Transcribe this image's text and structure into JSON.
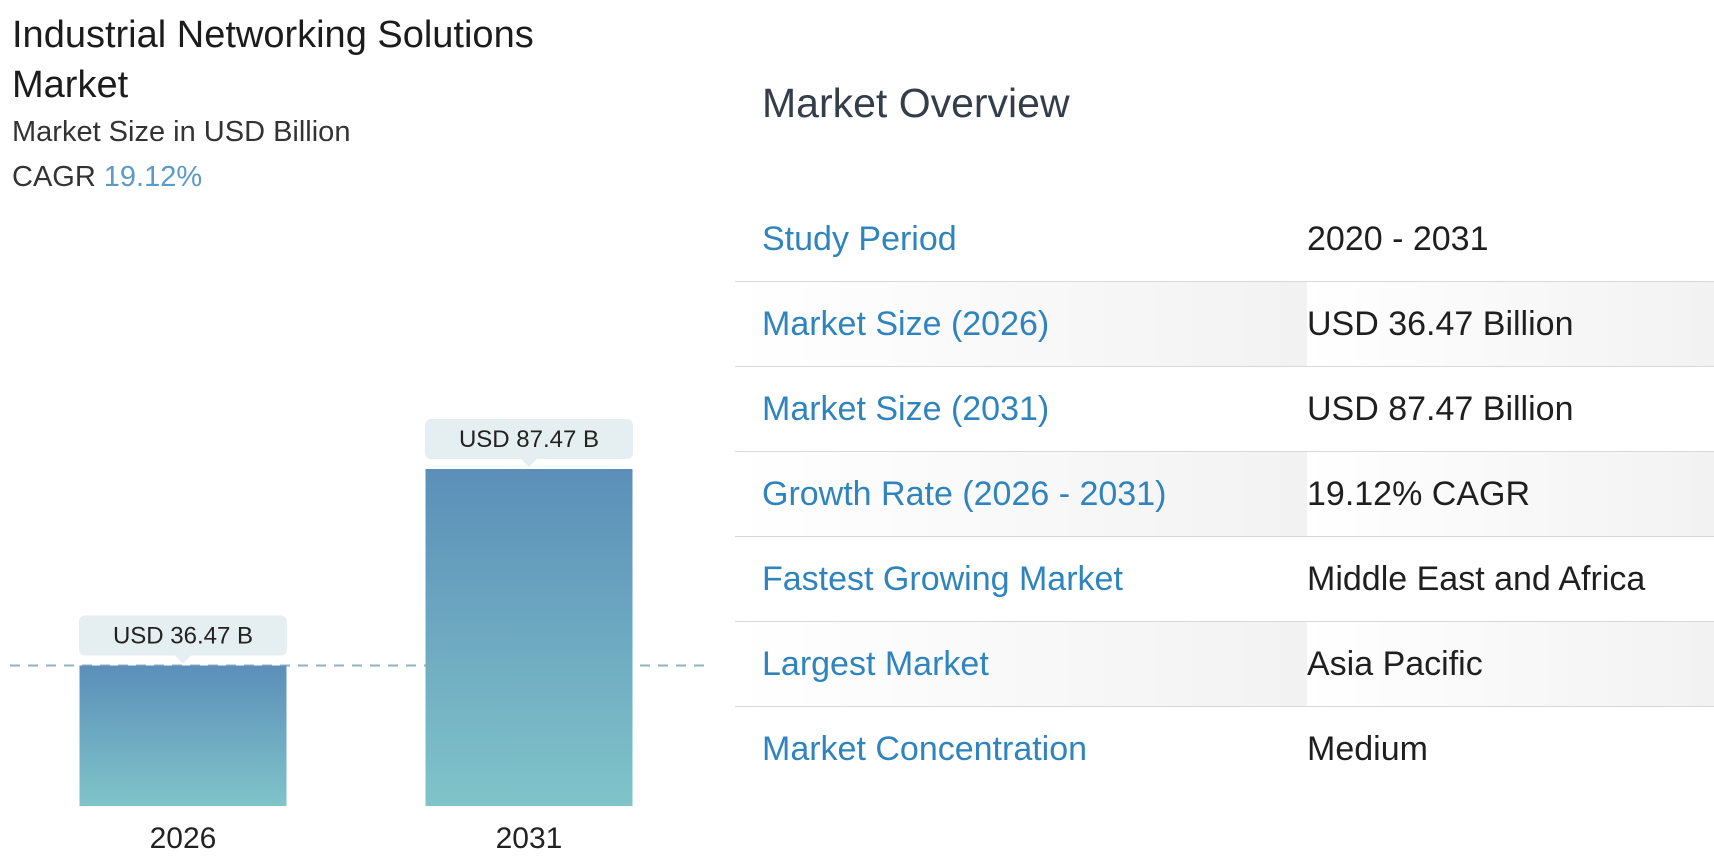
{
  "chart": {
    "title": "Industrial Networking Solutions Market",
    "subtitle": "Market Size in USD Billion",
    "cagr_label": "CAGR",
    "cagr_value": "19.12%"
  },
  "overview": {
    "title": "Market Overview",
    "rows": [
      {
        "label": "Study Period",
        "value": "2020 - 2031"
      },
      {
        "label": "Market Size (2026)",
        "value": "USD 36.47 Billion"
      },
      {
        "label": "Market Size (2031)",
        "value": "USD 87.47 Billion"
      },
      {
        "label": "Growth Rate (2026 - 2031)",
        "value": "19.12% CAGR"
      },
      {
        "label": "Fastest Growing Market",
        "value": "Middle East and Africa"
      },
      {
        "label": "Largest Market",
        "value": "Asia Pacific"
      },
      {
        "label": "Market Concentration",
        "value": "Medium"
      }
    ]
  },
  "colors": {
    "bar_top": "#5b8fb9",
    "bar_bottom": "#80c4c9",
    "accent": "#5b9bc9",
    "label_blue": "#2f84bd",
    "callout_bg": "#e5eef1"
  },
  "chart_data": {
    "type": "bar",
    "title": "Industrial Networking Solutions Market",
    "subtitle": "Market Size in USD Billion",
    "categories": [
      "2026",
      "2031"
    ],
    "values": [
      36.47,
      87.47
    ],
    "data_labels": [
      "USD 36.47 B",
      "USD 87.47 B"
    ],
    "reference_line": 36.47,
    "ylim": [
      0,
      87.47
    ],
    "xlabel": "",
    "ylabel": "",
    "grid": false,
    "legend": "none"
  }
}
